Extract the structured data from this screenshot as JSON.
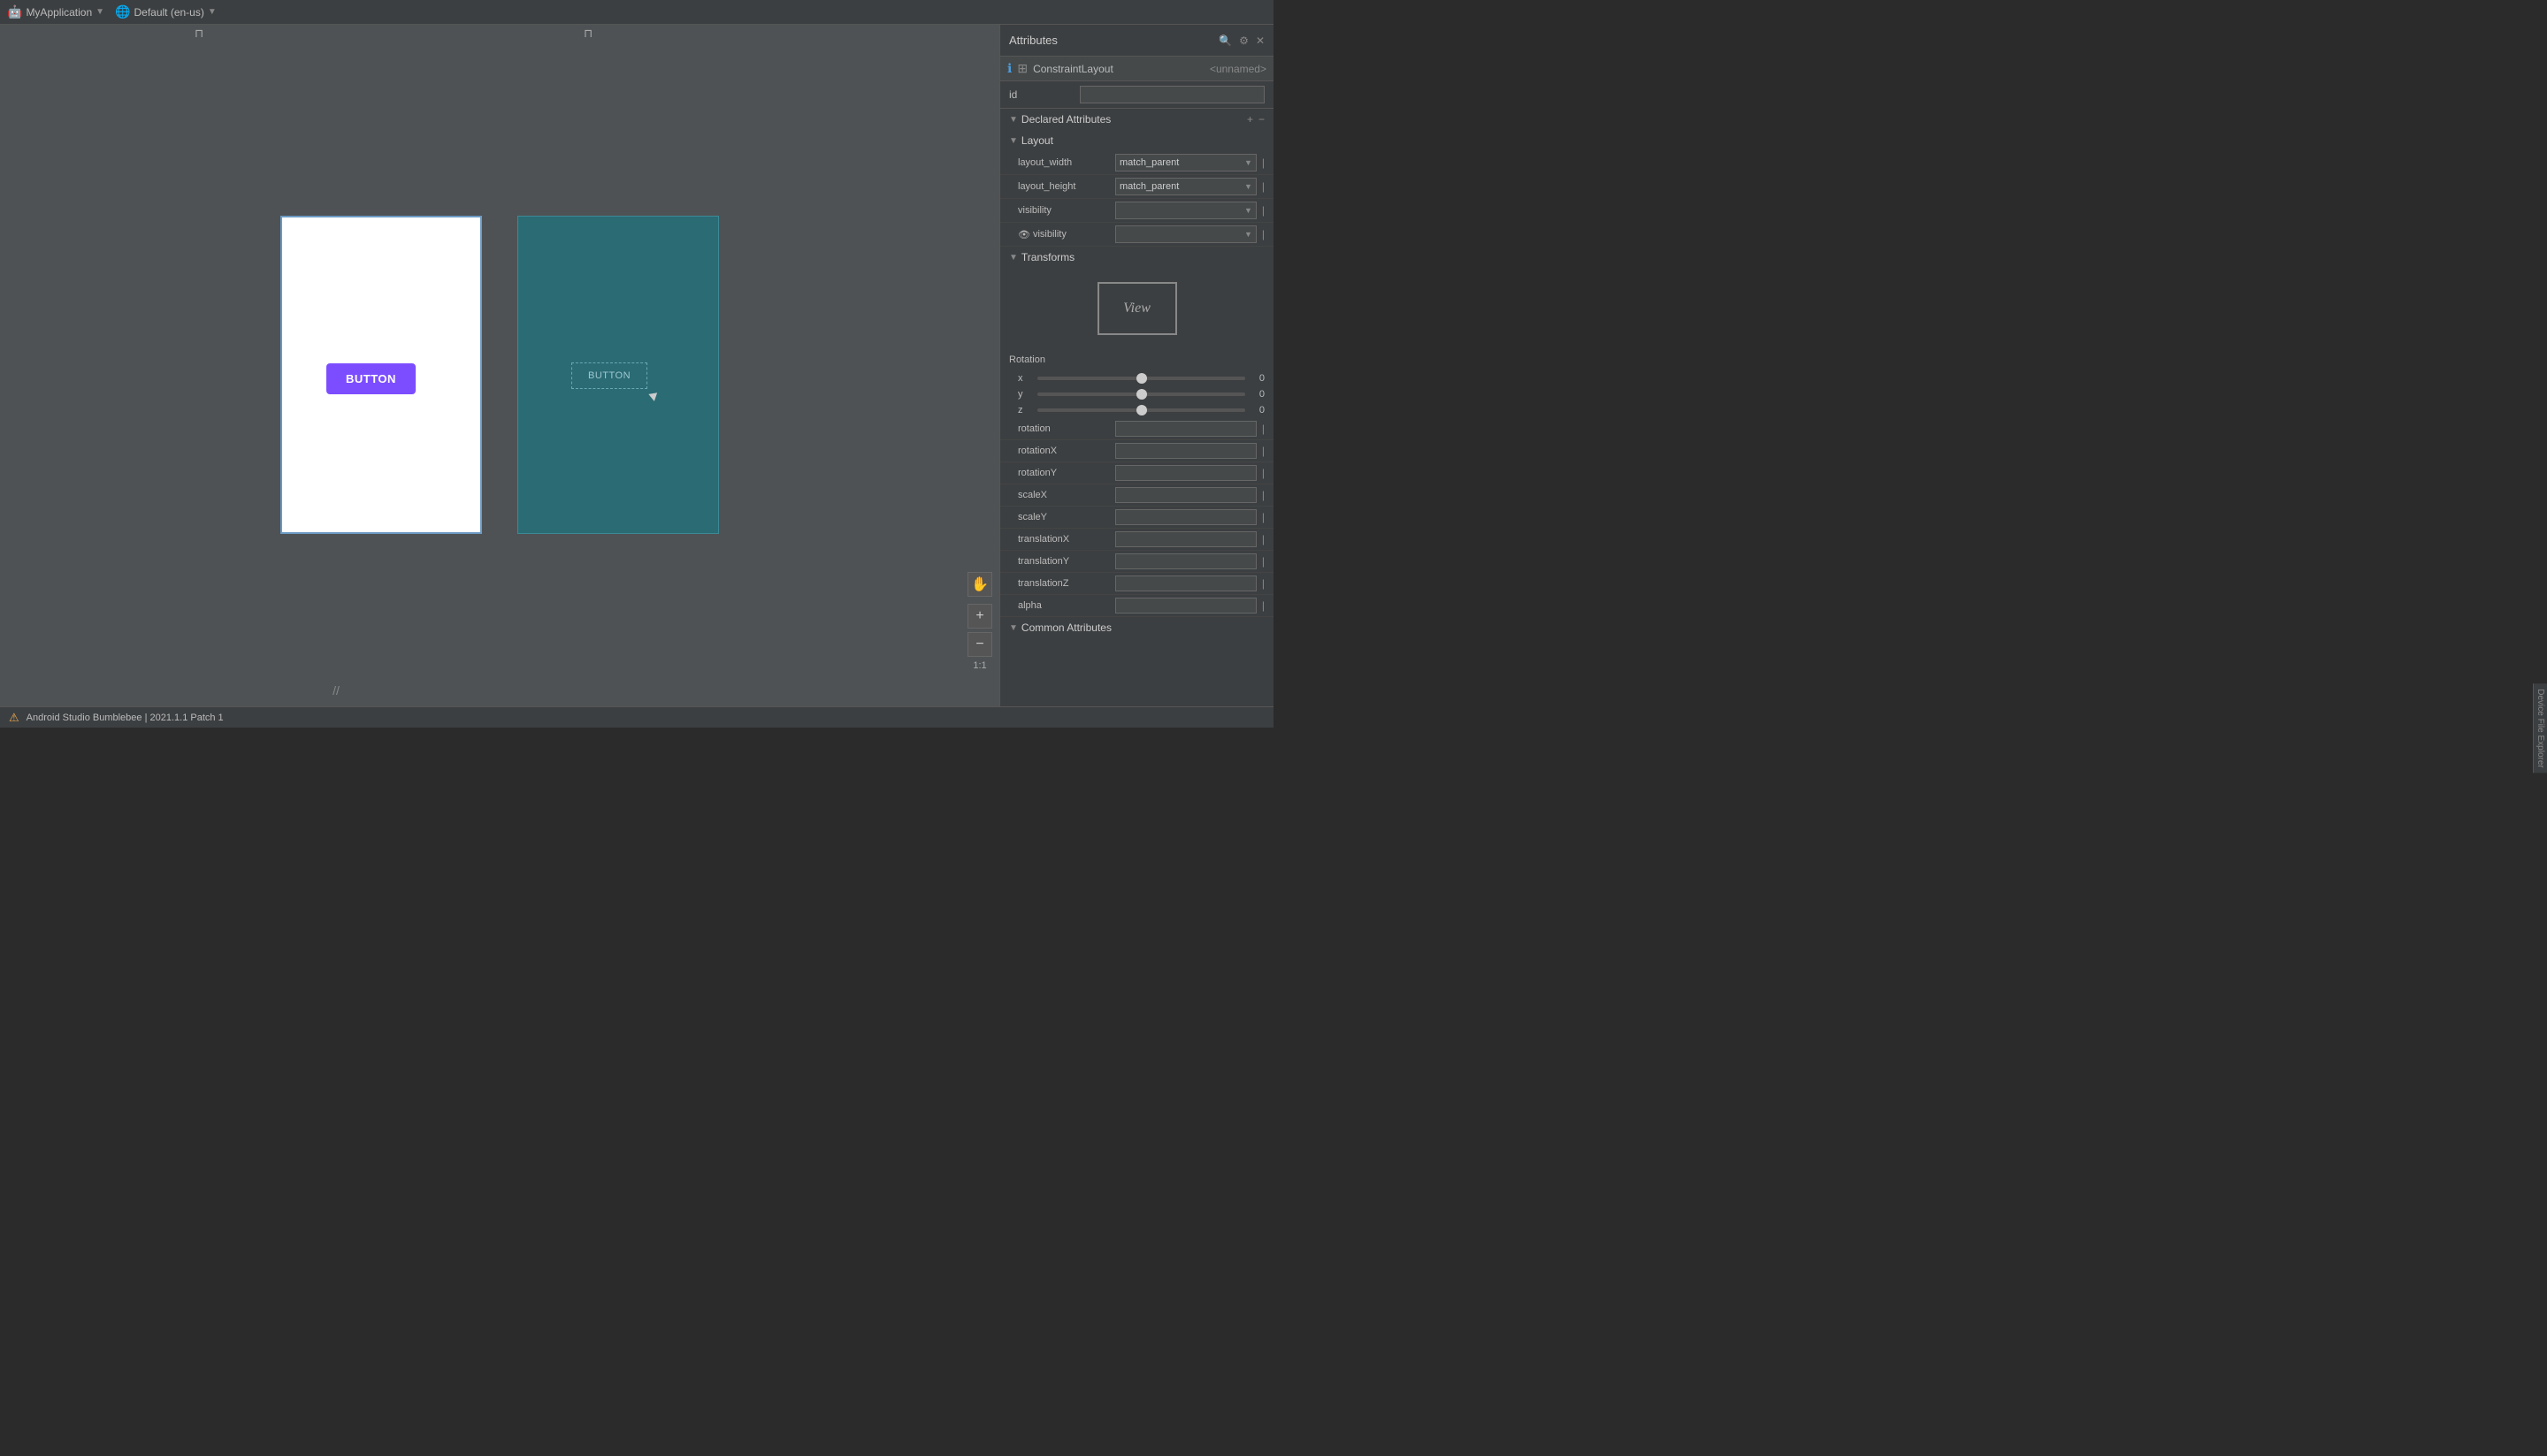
{
  "topbar": {
    "app_name": "MyApplication",
    "config_name": "Default (en-us)"
  },
  "canvas": {
    "pin_left": "📌",
    "pin_right": "📌",
    "light_button_label": "BUTTON",
    "dark_button_label": "BUTTON",
    "zoom_label": "1:1",
    "zoom_in": "+",
    "zoom_out": "−"
  },
  "panel": {
    "title": "Attributes",
    "constraint_layout": "ConstraintLayout",
    "unnamed": "<unnamed>",
    "id_label": "id",
    "declared_attributes_label": "Declared Attributes",
    "layout_section_label": "Layout",
    "layout_width_label": "layout_width",
    "layout_width_value": "match_parent",
    "layout_height_label": "layout_height",
    "layout_height_value": "match_parent",
    "visibility_label": "visibility",
    "visibility2_label": "visibility",
    "transforms_label": "Transforms",
    "view_preview_text": "View",
    "rotation_label": "Rotation",
    "rotation_x_label": "x",
    "rotation_x_value": "0",
    "rotation_y_label": "y",
    "rotation_y_value": "0",
    "rotation_z_label": "z",
    "rotation_z_value": "0",
    "rotation_attr_label": "rotation",
    "rotationX_label": "rotationX",
    "rotationY_label": "rotationY",
    "scaleX_label": "scaleX",
    "scaleY_label": "scaleY",
    "translationX_label": "translationX",
    "translationY_label": "translationY",
    "translationZ_label": "translationZ",
    "alpha_label": "alpha",
    "common_attributes_label": "Common Attributes"
  },
  "statusbar": {
    "text": "Android Studio Bumblebee | 2021.1.1 Patch 1"
  }
}
